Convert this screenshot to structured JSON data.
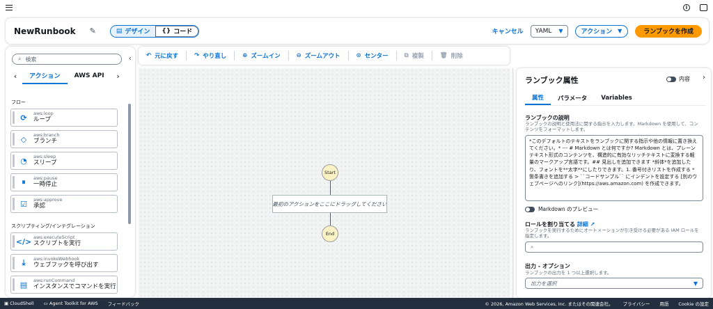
{
  "header": {
    "title": "NewRunbook",
    "design_label": "デザイン",
    "code_label": "コード",
    "cancel_label": "キャンセル",
    "format_value": "YAML",
    "actions_label": "アクション",
    "create_label": "ランブックを作成"
  },
  "left_panel": {
    "search_placeholder": "検索",
    "tabs": [
      "アクション",
      "AWS API"
    ],
    "section_flow": "フロー",
    "section_script": "スクリプティング/インテグレーション",
    "flow_items": [
      {
        "sub": "aws:loop",
        "name": "ループ",
        "icon": "loop-icon"
      },
      {
        "sub": "aws:branch",
        "name": "ブランチ",
        "icon": "branch-icon"
      },
      {
        "sub": "aws:sleep",
        "name": "スリープ",
        "icon": "sleep-icon"
      },
      {
        "sub": "aws:pause",
        "name": "一時停止",
        "icon": "pause-icon"
      },
      {
        "sub": "aws:approve",
        "name": "承認",
        "icon": "approve-icon"
      }
    ],
    "script_items": [
      {
        "sub": "aws:executeScript",
        "name": "スクリプトを実行",
        "icon": "code-icon"
      },
      {
        "sub": "aws:invokeWebhook",
        "name": "ウェブフックを呼び出す",
        "icon": "webhook-icon"
      },
      {
        "sub": "aws:runCommand",
        "name": "インスタンスでコマンドを実行",
        "icon": "command-icon"
      }
    ]
  },
  "toolbar": {
    "undo": "元に戻す",
    "redo": "やり直し",
    "zoom_in": "ズームイン",
    "zoom_out": "ズームアウト",
    "center": "センター",
    "copy": "複製",
    "delete": "削除"
  },
  "canvas": {
    "start_label": "Start",
    "end_label": "End",
    "drop_text": "最初のアクションをここにドラッグしてください"
  },
  "right_panel": {
    "title": "ランブック属性",
    "toggle_label": "内容",
    "tabs": [
      "属性",
      "パラメータ",
      "Variables"
    ],
    "desc_label": "ランブックの説明",
    "desc_help": "ランブックの説明と使用法に関する指示を入力します。Markdown を使用して、コンテンツをフォーマットします。",
    "desc_value": "*このデフォルトのテキストをランブックに関する指示や他の情報に置き換えてください。* --- # Markdown とは何ですか? Markdown とは、プレーンテキスト形式のコンテンツを、構造的に有効なリッチテキストに変換する軽量のマークアップ言語です。## 見出しを追加できます *斜体*を追加したり、フォントを**太字**にしたりできます。1. 番号付きリストを作成する * 箇条書きを追加する > ``コードサンプル`` にインデントを設定する [別のウェブページへのリンク](https://aws.amazon.com) を作成できます。",
    "preview_label": "Markdown のプレビュー",
    "role_label": "ロールを割り当てる",
    "role_link": "詳細",
    "role_help": "ランブックを実行するためにオートメーションが引き受ける必要がある IAM ロールを指定します。",
    "output_label": "出力 - オプション",
    "output_help": "ランブックの出力を 1 つ以上選択します。",
    "output_placeholder": "出力を選択"
  },
  "footer": {
    "cloudshell": "CloudShell",
    "toolkit": "Agent Toolkit for AWS",
    "feedback": "フィードバック",
    "copyright": "© 2026, Amazon Web Services, Inc. またはその関連会社。",
    "privacy": "プライバシー",
    "terms": "用語",
    "cookie": "Cookie の設定"
  }
}
